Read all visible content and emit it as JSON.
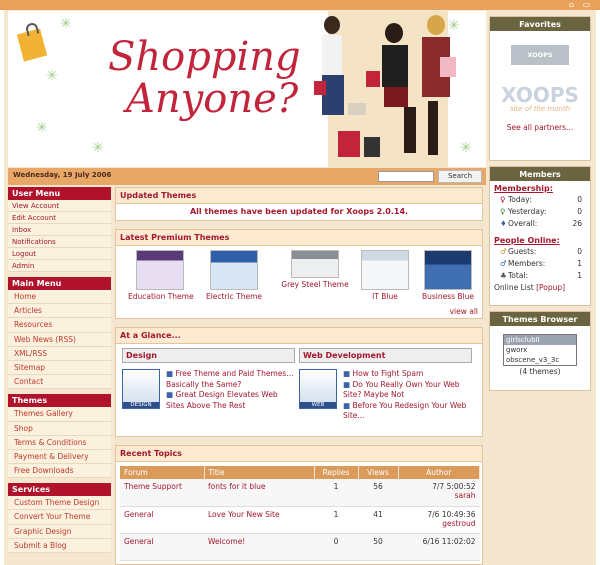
{
  "header": {
    "logo_line1": "Shopping",
    "logo_line2": "Anyone?",
    "date": "Wednesday, 19 July 2006",
    "search_button": "Search",
    "search_placeholder": ""
  },
  "left_menu": {
    "user_menu": {
      "title": "User Menu",
      "items": [
        "View Account",
        "Edit Account",
        "Inbox",
        "Notifications",
        "Logout",
        "Admin"
      ]
    },
    "main_menu": {
      "title": "Main Menu",
      "items": [
        "Home",
        "Articles",
        "Resources",
        "Web News (RSS)",
        "XML/RSS",
        "Sitemap",
        "Contact"
      ]
    },
    "themes": {
      "title": "Themes",
      "items": [
        "Themes Gallery",
        "Shop",
        "Terms & Conditions",
        "Payment & Delivery",
        "Free Downloads"
      ]
    },
    "services": {
      "title": "Services",
      "items": [
        "Custom Theme Design",
        "Convert Your Theme",
        "Graphic Design",
        "Submit a Blog"
      ]
    }
  },
  "main": {
    "updated": {
      "title": "Updated Themes",
      "message": "All themes have been updated for Xoops 2.0.14."
    },
    "premium": {
      "title": "Latest Premium Themes",
      "themes": [
        "Education Theme",
        "Electric Theme",
        "Grey Steel Theme",
        "IT Blue",
        "Business Blue"
      ],
      "view_all": "view all"
    },
    "glance": {
      "title": "At a Glance...",
      "design": {
        "heading": "Design",
        "icon_label": "DESIGN",
        "links": [
          "Free Theme and Paid Themes... Basically the Same?",
          "Great Design Elevates Web Sites Above The Rest"
        ]
      },
      "web": {
        "heading": "Web Development",
        "icon_label": "WEB",
        "links": [
          "How to Fight Spam",
          "Do You Really Own Your Web Site? Maybe Not",
          "Before You Redesign Your Web Site..."
        ]
      }
    },
    "recent": {
      "title": "Recent Topics",
      "columns": [
        "Forum",
        "Title",
        "Replies",
        "Views",
        "Author"
      ],
      "rows": [
        {
          "forum": "Theme Support",
          "title": "fonts for it blue",
          "replies": "1",
          "views": "56",
          "date": "7/7 5:00:52",
          "author": "sarah"
        },
        {
          "forum": "General",
          "title": "Love Your New Site",
          "replies": "1",
          "views": "41",
          "date": "7/6 10:49:36",
          "author": "gestroud"
        },
        {
          "forum": "General",
          "title": "Welcome!",
          "replies": "0",
          "views": "50",
          "date": "6/16 11:02:02",
          "author": ""
        }
      ]
    }
  },
  "right": {
    "favorites": {
      "title": "Favorites",
      "logo1": "XOOPS GROUPS",
      "logo2": "XOOPS",
      "logo2_sub": "site of the month",
      "see_all": "See all partners..."
    },
    "members": {
      "title": "Members",
      "membership_label": "Membership:",
      "stats": [
        {
          "icon": "today-icon",
          "label": "Today:",
          "value": "0"
        },
        {
          "icon": "yesterday-icon",
          "label": "Yesterday:",
          "value": "0"
        },
        {
          "icon": "overall-icon",
          "label": "Overall:",
          "value": "26"
        }
      ],
      "online_label": "People Online:",
      "online": [
        {
          "icon": "guests-icon",
          "label": "Guests:",
          "value": "0"
        },
        {
          "icon": "members-icon",
          "label": "Members:",
          "value": "1"
        },
        {
          "icon": "total-icon",
          "label": "Total:",
          "value": "1"
        }
      ],
      "online_list": "Online List",
      "popup": "[Popup]"
    },
    "themes_browser": {
      "title": "Themes Browser",
      "options": [
        "girlsclubII",
        "gworx",
        "obscene_v3_3c"
      ],
      "count": "(4 themes)"
    }
  }
}
